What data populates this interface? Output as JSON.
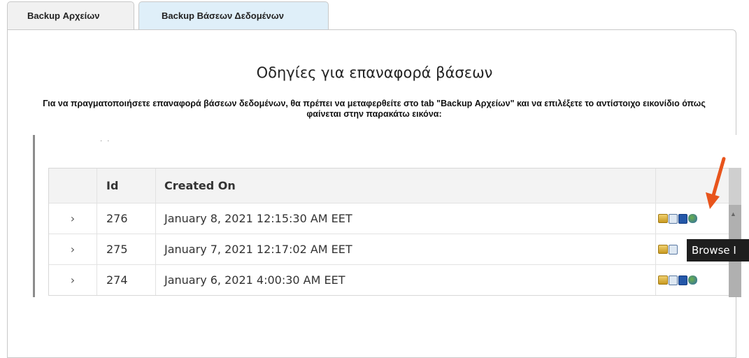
{
  "tabs": [
    {
      "label": "Backup Αρχείων",
      "active": false
    },
    {
      "label": "Backup Βάσεων Δεδομένων",
      "active": true
    }
  ],
  "heading": "Οδηγίες για επαναφορά βάσεων",
  "instructions": "Για να πραγματοποιήσετε επαναφορά βάσεων δεδομένων, θα πρέπει να μεταφερθείτε στο tab \"Backup Αρχείων\" και να επιλέξετε το αντίστοιχο εικονίδιο όπως φαίνεται στην παρακάτω εικόνα:",
  "image_grid": {
    "columns": [
      "Id",
      "Created On"
    ],
    "rows": [
      {
        "expander": "›",
        "id": "276",
        "created_on": "January 8, 2021 12:15:30 AM EET"
      },
      {
        "expander": "›",
        "id": "275",
        "created_on": "January 7, 2021 12:17:02 AM EET"
      },
      {
        "expander": "›",
        "id": "274",
        "created_on": "January 6, 2021 4:00:30 AM EET"
      }
    ],
    "row_icons": [
      "folder-icon",
      "browse-icon",
      "save-icon",
      "restore-icon"
    ],
    "tooltip": "Browse I",
    "accent_color": "#e8541c"
  },
  "colors": {
    "active_tab": "#dfeff9",
    "inactive_tab": "#f1f1f1",
    "arrow": "#e8541c"
  }
}
